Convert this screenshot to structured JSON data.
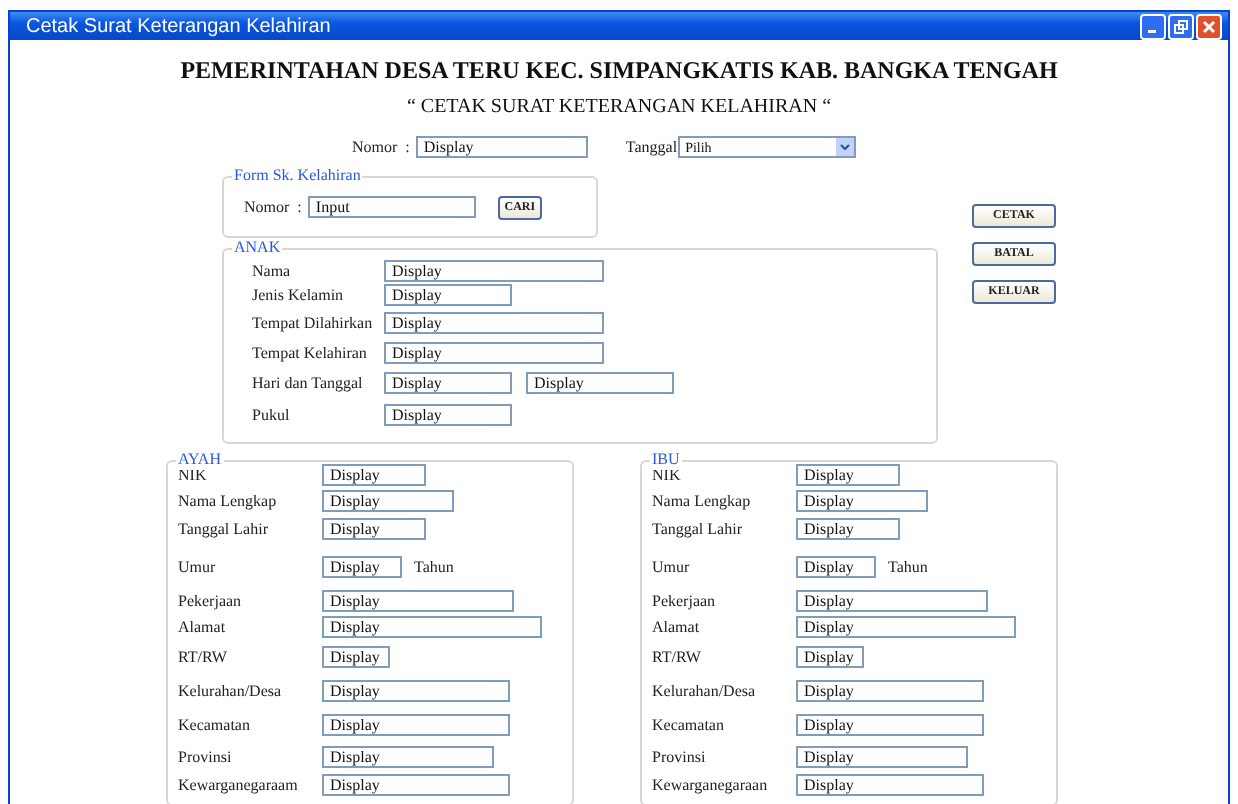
{
  "window": {
    "title": "Cetak Surat Keterangan Kelahiran"
  },
  "heading": "PEMERINTAHAN DESA TERU KEC. SIMPANGKATIS KAB. BANGKA TENGAH",
  "subheading": "“ CETAK SURAT KETERANGAN KELAHIRAN “",
  "nomor": {
    "label": "Nomor",
    "colon": ":",
    "value": "Display"
  },
  "tanggal": {
    "label": "Tanggal",
    "value": "Pilih"
  },
  "form_sk": {
    "title": "Form Sk. Kelahiran",
    "label": "Nomor",
    "colon": ":",
    "value": "Input",
    "button": "CARI"
  },
  "buttons": [
    "CETAK",
    "BATAL",
    "KELUAR"
  ],
  "anak": {
    "title": "ANAK",
    "fields": [
      {
        "label": "Nama",
        "values": [
          "Display"
        ]
      },
      {
        "label": "Jenis Kelamin",
        "values": [
          "Display"
        ]
      },
      {
        "label": "Tempat Dilahirkan",
        "values": [
          "Display"
        ]
      },
      {
        "label": "Tempat Kelahiran",
        "values": [
          "Display"
        ]
      },
      {
        "label": "Hari dan Tanggal",
        "values": [
          "Display",
          "Display"
        ]
      },
      {
        "label": "Pukul",
        "values": [
          "Display"
        ]
      }
    ]
  },
  "parents": [
    {
      "title": "AYAH",
      "fields": [
        {
          "label": "NIK",
          "value": "Display"
        },
        {
          "label": "Nama Lengkap",
          "value": "Display"
        },
        {
          "label": "Tanggal Lahir",
          "value": "Display"
        },
        {
          "label": "Umur",
          "value": "Display",
          "suffix": "Tahun"
        },
        {
          "label": "Pekerjaan",
          "value": "Display"
        },
        {
          "label": "Alamat",
          "value": "Display"
        },
        {
          "label": "RT/RW",
          "value": "Display"
        },
        {
          "label": "Kelurahan/Desa",
          "value": "Display"
        },
        {
          "label": "Kecamatan",
          "value": "Display"
        },
        {
          "label": "Provinsi",
          "value": "Display"
        },
        {
          "label": "Kewarganegaraam",
          "value": "Display"
        }
      ]
    },
    {
      "title": "IBU",
      "fields": [
        {
          "label": "NIK",
          "value": "Display"
        },
        {
          "label": "Nama Lengkap",
          "value": "Display"
        },
        {
          "label": "Tanggal Lahir",
          "value": "Display"
        },
        {
          "label": "Umur",
          "value": "Display",
          "suffix": "Tahun"
        },
        {
          "label": "Pekerjaan",
          "value": "Display"
        },
        {
          "label": "Alamat",
          "value": "Display"
        },
        {
          "label": "RT/RW",
          "value": "Display"
        },
        {
          "label": "Kelurahan/Desa",
          "value": "Display"
        },
        {
          "label": "Kecamatan",
          "value": "Display"
        },
        {
          "label": "Provinsi",
          "value": "Display"
        },
        {
          "label": "Kewarganegaraan",
          "value": "Display"
        }
      ]
    }
  ]
}
